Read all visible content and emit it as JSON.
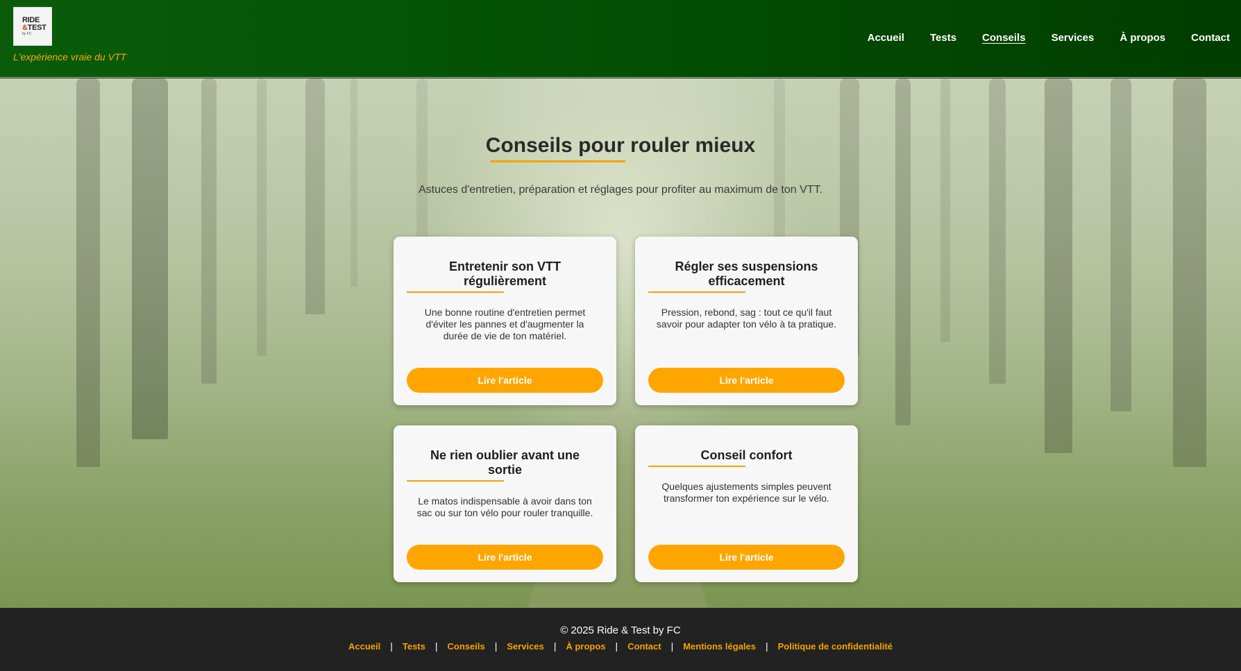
{
  "header": {
    "logo": {
      "line1": "RIDE",
      "line2_amp": "&",
      "line2": "TEST",
      "line3": "by FC"
    },
    "tagline": "L'expérience vraie du VTT",
    "nav": [
      {
        "label": "Accueil"
      },
      {
        "label": "Tests"
      },
      {
        "label": "Conseils",
        "active": true
      },
      {
        "label": "Services"
      },
      {
        "label": "À propos"
      },
      {
        "label": "Contact"
      }
    ]
  },
  "main": {
    "title": "Conseils pour rouler mieux",
    "subtitle": "Astuces d'entretien, préparation et réglages pour profiter au maximum de ton VTT.",
    "cards": [
      {
        "title": "Entretenir son VTT régulièrement",
        "text": "Une bonne routine d'entretien permet d'éviter les pannes et d'augmenter la durée de vie de ton matériel.",
        "button": "Lire l'article"
      },
      {
        "title": "Régler ses suspensions efficacement",
        "text": "Pression, rebond, sag : tout ce qu'il faut savoir pour adapter ton vélo à ta pratique.",
        "button": "Lire l'article"
      },
      {
        "title": "Ne rien oublier avant une sortie",
        "text": "Le matos indispensable à avoir dans ton sac ou sur ton vélo pour rouler tranquille.",
        "button": "Lire l'article"
      },
      {
        "title": "Conseil confort",
        "text": "Quelques ajustements simples peuvent transformer ton expérience sur le vélo.",
        "button": "Lire l'article"
      }
    ]
  },
  "footer": {
    "copyright": "© 2025 Ride & Test by FC",
    "links": [
      {
        "label": "Accueil"
      },
      {
        "label": "Tests"
      },
      {
        "label": "Conseils"
      },
      {
        "label": "Services"
      },
      {
        "label": "À propos"
      },
      {
        "label": "Contact"
      },
      {
        "label": "Mentions légales"
      },
      {
        "label": "Politique de confidentialité"
      }
    ],
    "separator": "|"
  },
  "colors": {
    "header_green": "#034f03",
    "accent_orange": "#ffa500",
    "footer_bg": "#222222",
    "card_bg": "#f7f7f7"
  }
}
